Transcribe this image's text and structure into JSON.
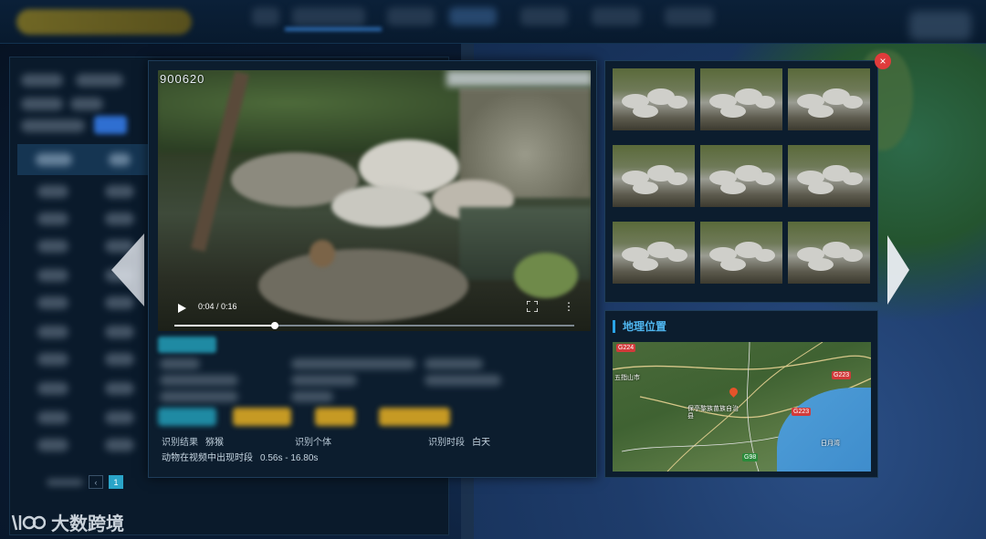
{
  "video": {
    "id_overlay": "900620",
    "time": "0:04 / 0:16",
    "progress": 0.25
  },
  "result": {
    "label_result": "识别结果",
    "value_result": "猕猴",
    "label_individual": "识别个体",
    "value_individual": "",
    "label_period": "识别时段",
    "value_period": "白天",
    "label_appear": "动物在视频中出现时段",
    "value_appear": "0.56s - 16.80s"
  },
  "geo": {
    "title": "地理位置",
    "roads": [
      "G224",
      "G223",
      "G223",
      "G98"
    ],
    "places": [
      "五指山市",
      "保亭黎族苗族自治县",
      "日月湾"
    ]
  },
  "pager": {
    "page": "1"
  },
  "close_icon": "×",
  "watermark": {
    "text": "大数跨境"
  }
}
